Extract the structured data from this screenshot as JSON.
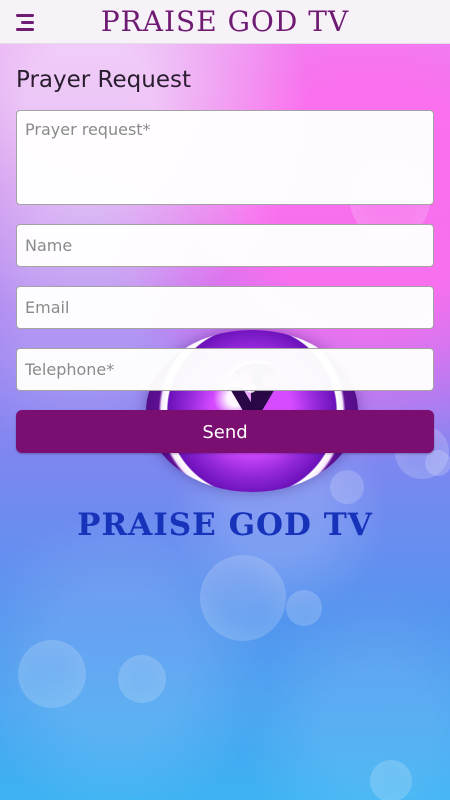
{
  "topbar": {
    "title": "PRAISE GOD TV",
    "menu_icon": "menu-icon"
  },
  "form": {
    "title": "Prayer Request",
    "prayer_request_placeholder": "Prayer request*",
    "name_placeholder": "Name",
    "email_placeholder": "Email",
    "telephone_placeholder": "Telephone*",
    "send_label": "Send"
  },
  "brand": {
    "name": "PRAISE GOD TV"
  },
  "colors": {
    "primary": "#7A0F71",
    "header_text": "#6F1B73",
    "brand_text": "#1733BA",
    "background_top": "#E690F2",
    "background_bottom": "#3DB3F3"
  }
}
